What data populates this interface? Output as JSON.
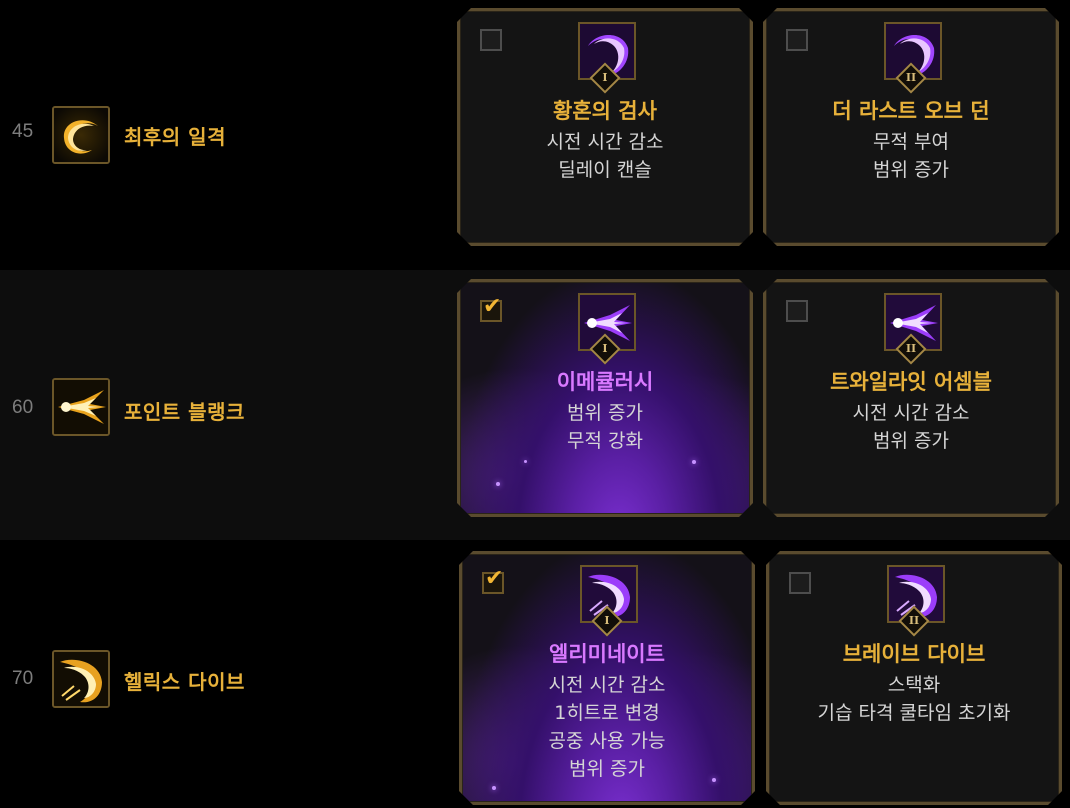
{
  "rows": [
    {
      "level": "45",
      "skill_name": "최후의 일격",
      "skill_icon": "golden-crescent-slash-icon",
      "options": [
        {
          "checked": false,
          "icon": "purple-crescent-icon",
          "badge": "I",
          "title": "황혼의 검사",
          "desc": [
            "시전 시간 감소",
            "딜레이 캔슬"
          ]
        },
        {
          "checked": false,
          "icon": "purple-crescent-icon",
          "badge": "II",
          "title": "더 라스트 오브 던",
          "desc": [
            "무적 부여",
            "범위 증가"
          ]
        }
      ]
    },
    {
      "level": "60",
      "skill_name": "포인트 블랭크",
      "skill_icon": "golden-burst-icon",
      "options": [
        {
          "checked": true,
          "icon": "purple-burst-icon",
          "badge": "I",
          "title": "이메큘러시",
          "desc": [
            "범위 증가",
            "무적 강화"
          ]
        },
        {
          "checked": false,
          "icon": "purple-burst-icon",
          "badge": "II",
          "title": "트와일라잇 어셈블",
          "desc": [
            "시전 시간 감소",
            "범위 증가"
          ]
        }
      ]
    },
    {
      "level": "70",
      "skill_name": "헬릭스 다이브",
      "skill_icon": "golden-spiral-dive-icon",
      "options": [
        {
          "checked": true,
          "icon": "purple-spiral-icon",
          "badge": "I",
          "title": "엘리미네이트",
          "desc": [
            "시전 시간 감소",
            "1히트로 변경",
            "공중 사용 가능",
            "범위 증가"
          ]
        },
        {
          "checked": false,
          "icon": "purple-spiral-icon",
          "badge": "II",
          "title": "브레이브 다이브",
          "desc": [
            "스택화",
            "기습 타격 쿨타임 초기화"
          ]
        }
      ]
    }
  ],
  "colors": {
    "gold": "#e7b13a",
    "selected_title": "#d979ff",
    "desc": "#d5d5d5",
    "level": "#7d7d7d",
    "card_border": "#5a4b2e"
  }
}
